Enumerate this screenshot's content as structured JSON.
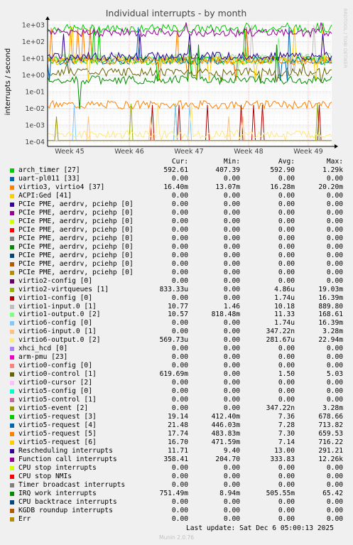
{
  "chart_data": {
    "type": "line",
    "title": "Individual interrupts - by month",
    "ylabel": "interrupts / second",
    "side_label": "RRDTOOL / TOBI OETIKER",
    "yscale": "log",
    "ylim": [
      0.0001,
      1500
    ],
    "x_ticks": [
      "Week 45",
      "Week 46",
      "Week 47",
      "Week 48",
      "Week 49"
    ],
    "y_ticks": [
      "1e+03",
      "1e+02",
      "1e+01",
      "1e+00",
      "1e-01",
      "1e-02",
      "1e-03",
      "1e-04"
    ],
    "columns": [
      "Cur:",
      "Min:",
      "Avg:",
      "Max:"
    ],
    "series": [
      {
        "name": "arch_timer [27]",
        "color": "#00cc00",
        "cur": "592.61",
        "min": "407.39",
        "avg": "592.90",
        "max": "1.29k"
      },
      {
        "name": "uart-pl011 [33]",
        "color": "#0066b3",
        "cur": "0.00",
        "min": "0.00",
        "avg": "0.00",
        "max": "0.00"
      },
      {
        "name": "virtio3, virtio4 [37]",
        "color": "#ff8000",
        "cur": "16.40m",
        "min": "13.07m",
        "avg": "16.28m",
        "max": "20.20m"
      },
      {
        "name": "ACPI:Ged [41]",
        "color": "#ffcc00",
        "cur": "0.00",
        "min": "0.00",
        "avg": "0.00",
        "max": "0.00"
      },
      {
        "name": "PCIe PME, aerdrv, pciehp [0]",
        "color": "#330099",
        "cur": "0.00",
        "min": "0.00",
        "avg": "0.00",
        "max": "0.00"
      },
      {
        "name": "PCIe PME, aerdrv, pciehp [0]",
        "color": "#990099",
        "cur": "0.00",
        "min": "0.00",
        "avg": "0.00",
        "max": "0.00"
      },
      {
        "name": "PCIe PME, aerdrv, pciehp [0]",
        "color": "#ccff00",
        "cur": "0.00",
        "min": "0.00",
        "avg": "0.00",
        "max": "0.00"
      },
      {
        "name": "PCIe PME, aerdrv, pciehp [0]",
        "color": "#ff0000",
        "cur": "0.00",
        "min": "0.00",
        "avg": "0.00",
        "max": "0.00"
      },
      {
        "name": "PCIe PME, aerdrv, pciehp [0]",
        "color": "#808080",
        "cur": "0.00",
        "min": "0.00",
        "avg": "0.00",
        "max": "0.00"
      },
      {
        "name": "PCIe PME, aerdrv, pciehp [0]",
        "color": "#008f00",
        "cur": "0.00",
        "min": "0.00",
        "avg": "0.00",
        "max": "0.00"
      },
      {
        "name": "PCIe PME, aerdrv, pciehp [0]",
        "color": "#00487d",
        "cur": "0.00",
        "min": "0.00",
        "avg": "0.00",
        "max": "0.00"
      },
      {
        "name": "PCIe PME, aerdrv, pciehp [0]",
        "color": "#b35a00",
        "cur": "0.00",
        "min": "0.00",
        "avg": "0.00",
        "max": "0.00"
      },
      {
        "name": "PCIe PME, aerdrv, pciehp [0]",
        "color": "#b38f00",
        "cur": "0.00",
        "min": "0.00",
        "avg": "0.00",
        "max": "0.00"
      },
      {
        "name": "virtio2-config [0]",
        "color": "#6b006b",
        "cur": "0.00",
        "min": "0.00",
        "avg": "0.00",
        "max": "0.00"
      },
      {
        "name": "virtio2-virtqueues [1]",
        "color": "#8fb300",
        "cur": "833.33u",
        "min": "0.00",
        "avg": "4.86u",
        "max": "19.03m"
      },
      {
        "name": "virtio1-config [0]",
        "color": "#b30000",
        "cur": "0.00",
        "min": "0.00",
        "avg": "1.74u",
        "max": "16.39m"
      },
      {
        "name": "virtio1-input.0 [1]",
        "color": "#bebebe",
        "cur": "10.77",
        "min": "1.46",
        "avg": "10.18",
        "max": "889.80"
      },
      {
        "name": "virtio1-output.0 [2]",
        "color": "#80ff80",
        "cur": "10.57",
        "min": "818.48m",
        "avg": "11.33",
        "max": "168.61"
      },
      {
        "name": "virtio6-config [0]",
        "color": "#80c9ff",
        "cur": "0.00",
        "min": "0.00",
        "avg": "1.74u",
        "max": "16.39m"
      },
      {
        "name": "virtio6-input.0 [1]",
        "color": "#ffc080",
        "cur": "0.00",
        "min": "0.00",
        "avg": "347.22n",
        "max": "3.28m"
      },
      {
        "name": "virtio6-output.0 [2]",
        "color": "#ffe680",
        "cur": "569.73u",
        "min": "0.00",
        "avg": "281.67u",
        "max": "22.94m"
      },
      {
        "name": "xhci_hcd [0]",
        "color": "#aa80ff",
        "cur": "0.00",
        "min": "0.00",
        "avg": "0.00",
        "max": "0.00"
      },
      {
        "name": "arm-pmu [23]",
        "color": "#ee00cc",
        "cur": "0.00",
        "min": "0.00",
        "avg": "0.00",
        "max": "0.00"
      },
      {
        "name": "virtio0-config [0]",
        "color": "#ff8080",
        "cur": "0.00",
        "min": "0.00",
        "avg": "0.00",
        "max": "0.00"
      },
      {
        "name": "virtio0-control [1]",
        "color": "#666600",
        "cur": "619.69m",
        "min": "0.00",
        "avg": "1.50",
        "max": "5.03"
      },
      {
        "name": "virtio0-cursor [2]",
        "color": "#ffbfff",
        "cur": "0.00",
        "min": "0.00",
        "avg": "0.00",
        "max": "0.00"
      },
      {
        "name": "virtio5-config [0]",
        "color": "#00ffcc",
        "cur": "0.00",
        "min": "0.00",
        "avg": "0.00",
        "max": "0.00"
      },
      {
        "name": "virtio5-control [1]",
        "color": "#cc6699",
        "cur": "0.00",
        "min": "0.00",
        "avg": "0.00",
        "max": "0.00"
      },
      {
        "name": "virtio5-event [2]",
        "color": "#999900",
        "cur": "0.00",
        "min": "0.00",
        "avg": "347.22n",
        "max": "3.28m"
      },
      {
        "name": "virtio5-request [3]",
        "color": "#00cc00",
        "cur": "19.14",
        "min": "412.40m",
        "avg": "7.36",
        "max": "678.66"
      },
      {
        "name": "virtio5-request [4]",
        "color": "#0066b3",
        "cur": "21.48",
        "min": "446.03m",
        "avg": "7.28",
        "max": "713.82"
      },
      {
        "name": "virtio5-request [5]",
        "color": "#ff8000",
        "cur": "17.74",
        "min": "483.83m",
        "avg": "7.30",
        "max": "659.53"
      },
      {
        "name": "virtio5-request [6]",
        "color": "#ffcc00",
        "cur": "16.70",
        "min": "471.59m",
        "avg": "7.14",
        "max": "716.22"
      },
      {
        "name": "Rescheduling interrupts",
        "color": "#330099",
        "cur": "11.71",
        "min": "9.40",
        "avg": "13.00",
        "max": "291.21"
      },
      {
        "name": "Function call interrupts",
        "color": "#990099",
        "cur": "358.41",
        "min": "204.70",
        "avg": "333.83",
        "max": "12.26k"
      },
      {
        "name": "CPU stop interrupts",
        "color": "#ccff00",
        "cur": "0.00",
        "min": "0.00",
        "avg": "0.00",
        "max": "0.00"
      },
      {
        "name": "CPU stop NMIs",
        "color": "#ff0000",
        "cur": "0.00",
        "min": "0.00",
        "avg": "0.00",
        "max": "0.00"
      },
      {
        "name": "Timer broadcast interrupts",
        "color": "#808080",
        "cur": "0.00",
        "min": "0.00",
        "avg": "0.00",
        "max": "0.00"
      },
      {
        "name": "IRQ work interrupts",
        "color": "#008f00",
        "cur": "751.49m",
        "min": "8.94m",
        "avg": "505.55m",
        "max": "65.42"
      },
      {
        "name": "CPU backtrace interrupts",
        "color": "#00487d",
        "cur": "0.00",
        "min": "0.00",
        "avg": "0.00",
        "max": "0.00"
      },
      {
        "name": "KGDB roundup interrupts",
        "color": "#b35a00",
        "cur": "0.00",
        "min": "0.00",
        "avg": "0.00",
        "max": "0.00"
      },
      {
        "name": "Err",
        "color": "#b38f00",
        "cur": "0.00",
        "min": "0.00",
        "avg": "0.00",
        "max": "0.00"
      }
    ]
  },
  "footer": {
    "last_update": "Last update: Sat Dec  6 05:00:13 2025",
    "version": "Munin 2.0.76"
  }
}
